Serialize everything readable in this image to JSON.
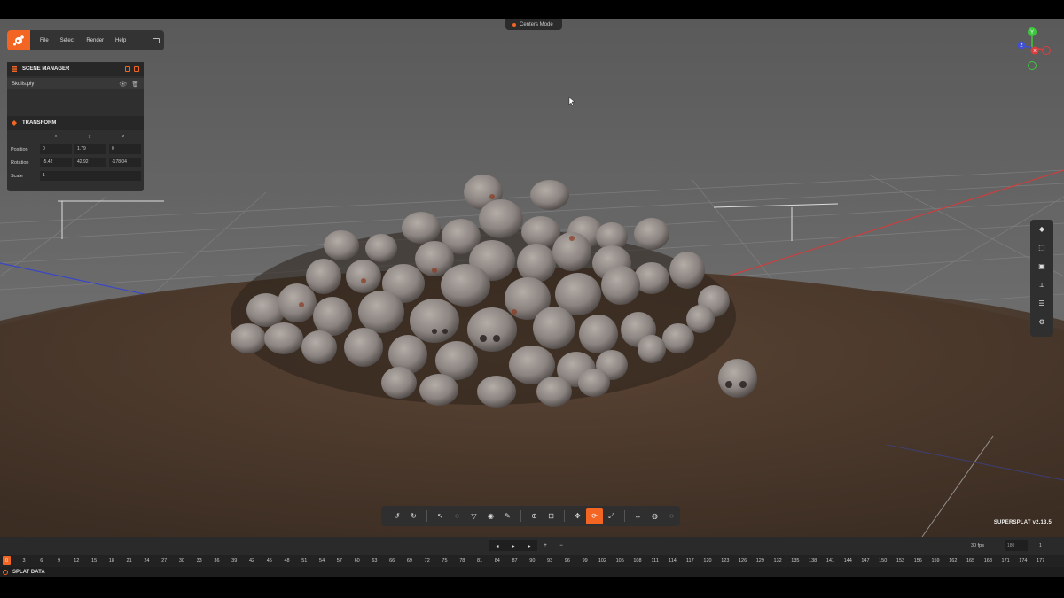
{
  "mode_pill": "Centers Mode",
  "menu": {
    "items": [
      "File",
      "Select",
      "Render",
      "Help"
    ]
  },
  "scene_manager": {
    "title": "SCENE MANAGER",
    "file": "Skulls.ply"
  },
  "transform": {
    "title": "TRANSFORM",
    "axes": [
      "x",
      "y",
      "z"
    ],
    "position_label": "Position",
    "position": [
      "0",
      "1.79",
      "0"
    ],
    "rotation_label": "Rotation",
    "rotation": [
      "-5.42",
      "42.92",
      "-178.04"
    ],
    "scale_label": "Scale",
    "scale": "1"
  },
  "gizmo": {
    "y": "Y",
    "x": "X",
    "z": "Z"
  },
  "version": "SUPERSPLAT v2.13.5",
  "timeline": {
    "fps": "30 fps",
    "total": "180",
    "end": "1",
    "current_frame": "0",
    "frames": [
      "3",
      "6",
      "9",
      "12",
      "15",
      "18",
      "21",
      "24",
      "27",
      "30",
      "33",
      "36",
      "39",
      "42",
      "45",
      "48",
      "51",
      "54",
      "57",
      "60",
      "63",
      "66",
      "69",
      "72",
      "75",
      "78",
      "81",
      "84",
      "87",
      "90",
      "93",
      "96",
      "99",
      "102",
      "105",
      "108",
      "111",
      "114",
      "117",
      "120",
      "123",
      "126",
      "129",
      "132",
      "135",
      "138",
      "141",
      "144",
      "147",
      "150",
      "153",
      "156",
      "159",
      "162",
      "165",
      "168",
      "171",
      "174",
      "177"
    ]
  },
  "bottom_panel": "SPLAT DATA",
  "colors": {
    "accent": "#f26522",
    "panel": "#2f2f2f",
    "x_axis": "#d84040",
    "z_axis": "#4050d0",
    "y_axis": "#3cc83c"
  }
}
